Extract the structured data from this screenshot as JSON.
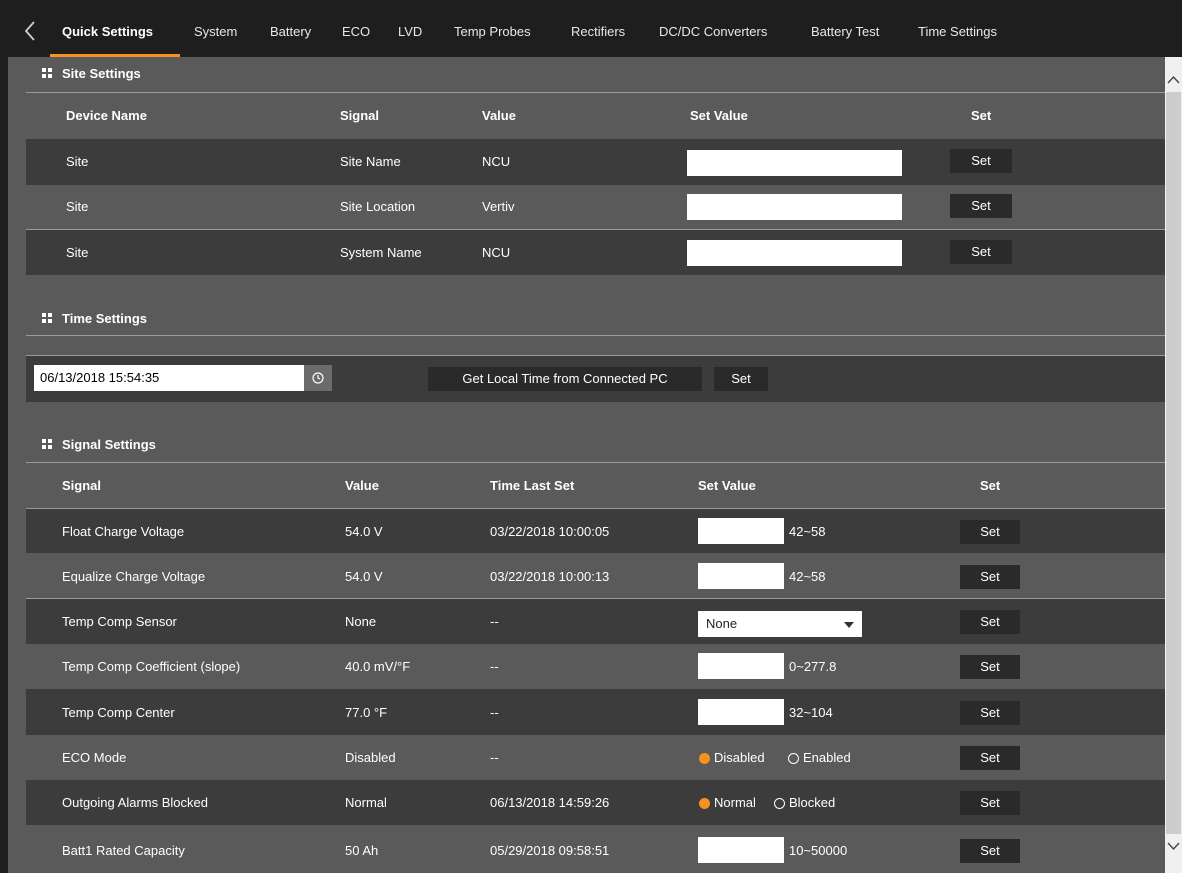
{
  "tabs": [
    {
      "label": "Quick Settings",
      "active": true
    },
    {
      "label": "System"
    },
    {
      "label": "Battery"
    },
    {
      "label": "ECO"
    },
    {
      "label": "LVD"
    },
    {
      "label": "Temp Probes"
    },
    {
      "label": "Rectifiers"
    },
    {
      "label": "DC/DC Converters"
    },
    {
      "label": "Battery Test"
    },
    {
      "label": "Time Settings"
    }
  ],
  "accent_color": "#f6921e",
  "site_settings": {
    "title": "Site Settings",
    "headers": [
      "Device Name",
      "Signal",
      "Value",
      "Set Value",
      "Set"
    ],
    "rows": [
      {
        "device": "Site",
        "signal": "Site Name",
        "value": "NCU",
        "set_value": "",
        "button": "Set"
      },
      {
        "device": "Site",
        "signal": "Site Location",
        "value": "Vertiv",
        "set_value": "",
        "button": "Set"
      },
      {
        "device": "Site",
        "signal": "System Name",
        "value": "NCU",
        "set_value": "",
        "button": "Set"
      }
    ]
  },
  "time_settings": {
    "title": "Time Settings",
    "datetime": "06/13/2018 15:54:35",
    "get_local_time_label": "Get Local Time from Connected PC",
    "set_label": "Set"
  },
  "signal_settings": {
    "title": "Signal Settings",
    "headers": [
      "Signal",
      "Value",
      "Time Last Set",
      "Set Value",
      "Set"
    ],
    "rows": [
      {
        "signal": "Float Charge Voltage",
        "value": "54.0 V",
        "time": "03/22/2018 10:00:05",
        "control": "input",
        "range": "42~58",
        "button": "Set"
      },
      {
        "signal": "Equalize Charge Voltage",
        "value": "54.0 V",
        "time": "03/22/2018 10:00:13",
        "control": "input",
        "range": "42~58",
        "button": "Set"
      },
      {
        "signal": "Temp Comp Sensor",
        "value": "None",
        "time": "--",
        "control": "select",
        "selected": "None",
        "button": "Set"
      },
      {
        "signal": "Temp Comp Coefficient (slope)",
        "value": "40.0 mV/°F",
        "time": "--",
        "control": "input",
        "range": "0~277.8",
        "button": "Set"
      },
      {
        "signal": "Temp Comp Center",
        "value": "77.0 °F",
        "time": "--",
        "control": "input",
        "range": "32~104",
        "button": "Set"
      },
      {
        "signal": "ECO Mode",
        "value": "Disabled",
        "time": "--",
        "control": "radio",
        "options": [
          "Disabled",
          "Enabled"
        ],
        "selected_index": 0,
        "button": "Set"
      },
      {
        "signal": "Outgoing Alarms Blocked",
        "value": "Normal",
        "time": "06/13/2018 14:59:26",
        "control": "radio",
        "options": [
          "Normal",
          "Blocked"
        ],
        "selected_index": 0,
        "button": "Set"
      },
      {
        "signal": "Batt1 Rated Capacity",
        "value": "50 Ah",
        "time": "05/29/2018 09:58:51",
        "control": "input",
        "range": "10~50000",
        "button": "Set"
      }
    ]
  }
}
